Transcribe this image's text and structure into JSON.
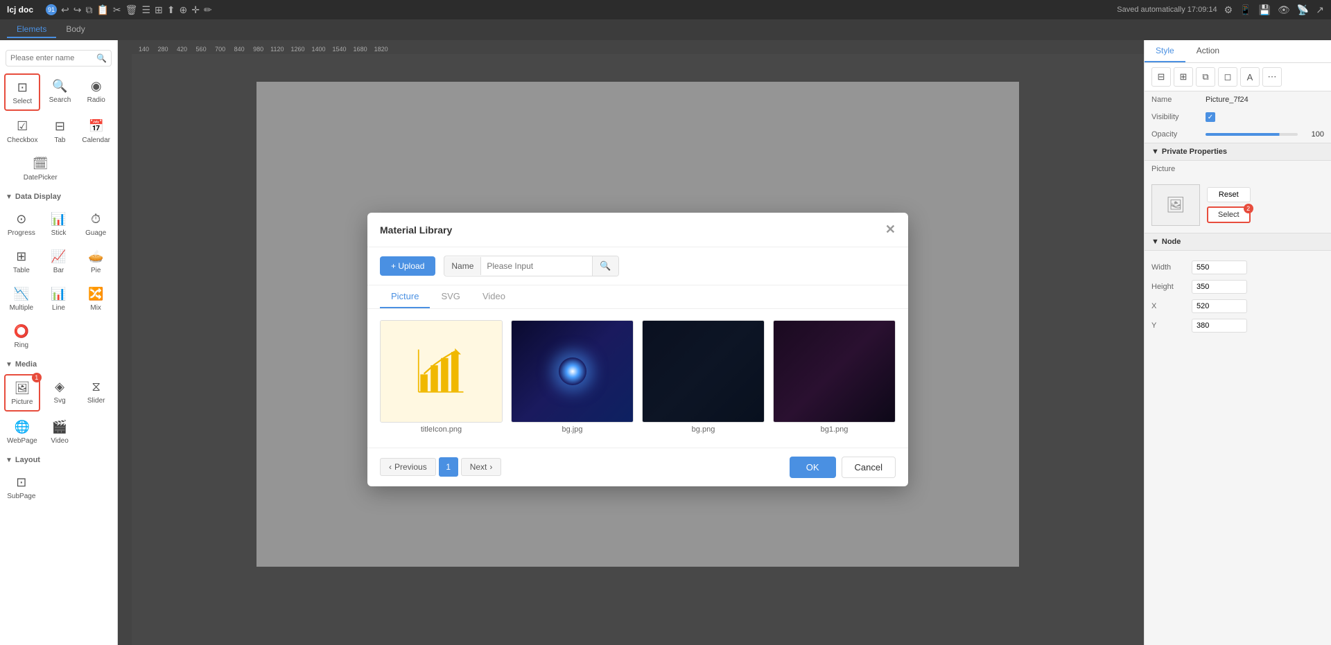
{
  "app": {
    "title": "lcj doc",
    "saved_status": "Saved automatically 17:09:14",
    "notification_count": "91"
  },
  "tabs": {
    "elements_label": "Elemets",
    "body_label": "Body"
  },
  "left_sidebar": {
    "search_placeholder": "Please enter name",
    "select_label": "Select",
    "search_label": "Search",
    "radio_label": "Radio",
    "checkbox_label": "Checkbox",
    "tab_label": "Tab",
    "calendar_label": "Calendar",
    "datepicker_label": "DatePicker",
    "data_display_section": "Data Display",
    "progress_label": "Progress",
    "stick_label": "Stick",
    "guage_label": "Guage",
    "table_label": "Table",
    "bar_label": "Bar",
    "pie_label": "Pie",
    "multiple_label": "Multiple",
    "line_label": "Line",
    "mix_label": "Mix",
    "ring_label": "Ring",
    "media_section": "Media",
    "picture_label": "Picture",
    "svg_label": "Svg",
    "slider_label": "Slider",
    "webpage_label": "WebPage",
    "video_label": "Video",
    "layout_section": "Layout",
    "subpage_label": "SubPage"
  },
  "right_panel": {
    "style_tab": "Style",
    "action_tab": "Action",
    "name_label": "Name",
    "name_value": "Picture_7f24",
    "visibility_label": "Visibility",
    "opacity_label": "Opacity",
    "opacity_value": "100",
    "private_props_label": "Private Properties",
    "picture_label": "Picture",
    "reset_label": "Reset",
    "select_label": "Select",
    "node_section": "Node",
    "width_label": "Width",
    "width_value": "550",
    "height_label": "Height",
    "height_value": "350",
    "x_label": "X",
    "x_value": "520",
    "y_label": "Y",
    "y_value": "380",
    "select_badge": "2"
  },
  "modal": {
    "title": "Material Library",
    "upload_label": "+ Upload",
    "name_label": "Name",
    "name_placeholder": "Please Input",
    "tabs": [
      "Picture",
      "SVG",
      "Video"
    ],
    "active_tab": "Picture",
    "images": [
      {
        "name": "titleIcon.png",
        "type": "chart"
      },
      {
        "name": "bg.jpg",
        "type": "space"
      },
      {
        "name": "bg.png",
        "type": "dark"
      },
      {
        "name": "bg1.png",
        "type": "dark2"
      }
    ],
    "previous_label": "Previous",
    "next_label": "Next",
    "page_number": "1",
    "ok_label": "OK",
    "cancel_label": "Cancel"
  }
}
